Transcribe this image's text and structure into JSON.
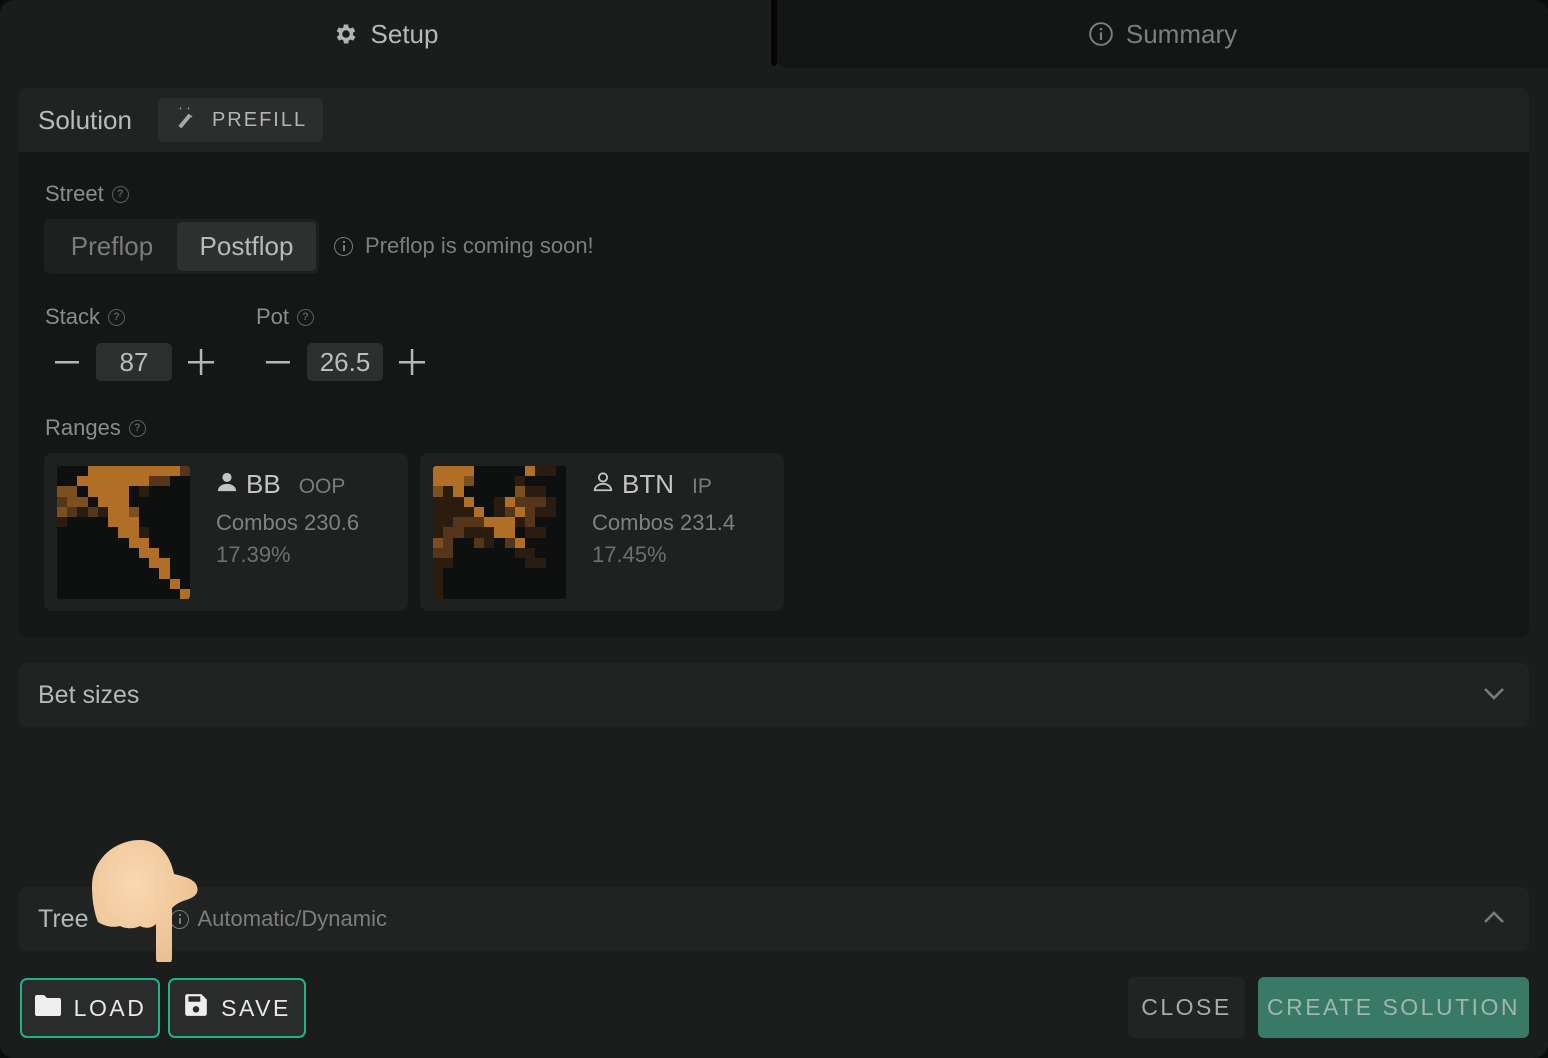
{
  "tabs": [
    {
      "label": "Setup",
      "icon": "gear-icon",
      "active": true
    },
    {
      "label": "Summary",
      "icon": "info-icon",
      "active": false
    }
  ],
  "solution": {
    "title": "Solution",
    "prefill_label": "PREFILL",
    "street": {
      "label": "Street",
      "options": [
        "Preflop",
        "Postflop"
      ],
      "selected": "Postflop",
      "note": "Preflop is coming soon!"
    },
    "stack": {
      "label": "Stack",
      "value": "87"
    },
    "pot": {
      "label": "Pot",
      "value": "26.5"
    },
    "ranges": {
      "label": "Ranges",
      "players": [
        {
          "name": "BB",
          "position": "OOP",
          "combos": "Combos 230.6",
          "percent": "17.39%",
          "icon": "user-filled-icon",
          "grid": [
            [
              0,
              0,
              0,
              4,
              4,
              4,
              4,
              4,
              4,
              4,
              4,
              4,
              2
            ],
            [
              0,
              0,
              4,
              4,
              4,
              4,
              4,
              4,
              4,
              2,
              2,
              0,
              0
            ],
            [
              3,
              3,
              0,
              4,
              4,
              4,
              4,
              0,
              1,
              0,
              0,
              0,
              0
            ],
            [
              2,
              3,
              3,
              0,
              4,
              4,
              4,
              0,
              0,
              0,
              0,
              0,
              0
            ],
            [
              3,
              2,
              1,
              2,
              1,
              4,
              4,
              3,
              0,
              0,
              0,
              0,
              0
            ],
            [
              1,
              0,
              0,
              0,
              0,
              4,
              4,
              4,
              0,
              0,
              0,
              0,
              0
            ],
            [
              0,
              0,
              0,
              0,
              0,
              0,
              4,
              4,
              1,
              0,
              0,
              0,
              0
            ],
            [
              0,
              0,
              0,
              0,
              0,
              0,
              0,
              4,
              4,
              0,
              0,
              0,
              0
            ],
            [
              0,
              0,
              0,
              0,
              0,
              0,
              0,
              0,
              4,
              4,
              0,
              0,
              0
            ],
            [
              0,
              0,
              0,
              0,
              0,
              0,
              0,
              0,
              0,
              4,
              4,
              0,
              0
            ],
            [
              0,
              0,
              0,
              0,
              0,
              0,
              0,
              0,
              0,
              0,
              4,
              0,
              0
            ],
            [
              0,
              0,
              0,
              0,
              0,
              0,
              0,
              0,
              0,
              0,
              0,
              4,
              0
            ],
            [
              0,
              0,
              0,
              0,
              0,
              0,
              0,
              0,
              0,
              0,
              0,
              0,
              4
            ]
          ]
        },
        {
          "name": "BTN",
          "position": "IP",
          "combos": "Combos 231.4",
          "percent": "17.45%",
          "icon": "user-outline-icon",
          "grid": [
            [
              4,
              4,
              4,
              4,
              0,
              0,
              0,
              0,
              0,
              4,
              1,
              1,
              0
            ],
            [
              4,
              4,
              4,
              3,
              0,
              0,
              0,
              0,
              1,
              0,
              0,
              0,
              0
            ],
            [
              3,
              1,
              4,
              0,
              0,
              0,
              0,
              0,
              3,
              1,
              1,
              0,
              0
            ],
            [
              1,
              1,
              1,
              4,
              0,
              0,
              1,
              4,
              2,
              2,
              2,
              1,
              0
            ],
            [
              1,
              1,
              1,
              1,
              4,
              0,
              1,
              2,
              4,
              2,
              1,
              1,
              0
            ],
            [
              1,
              1,
              2,
              2,
              2,
              4,
              4,
              4,
              1,
              2,
              0,
              0,
              0
            ],
            [
              1,
              2,
              2,
              1,
              1,
              1,
              4,
              4,
              0,
              1,
              1,
              0,
              0
            ],
            [
              3,
              2,
              0,
              0,
              2,
              1,
              0,
              2,
              4,
              0,
              0,
              0,
              0
            ],
            [
              2,
              2,
              0,
              0,
              0,
              0,
              0,
              0,
              1,
              1,
              0,
              0,
              0
            ],
            [
              1,
              1,
              0,
              0,
              0,
              0,
              0,
              0,
              0,
              1,
              1,
              0,
              0
            ],
            [
              1,
              0,
              0,
              0,
              0,
              0,
              0,
              0,
              0,
              0,
              0,
              0,
              0
            ],
            [
              1,
              0,
              0,
              0,
              0,
              0,
              0,
              0,
              0,
              0,
              0,
              0,
              0
            ],
            [
              1,
              0,
              0,
              0,
              0,
              0,
              0,
              0,
              0,
              0,
              0,
              0,
              0
            ]
          ]
        }
      ]
    }
  },
  "bet_sizes": {
    "title": "Bet sizes",
    "expanded": false
  },
  "tree": {
    "title": "Tree",
    "subtitle": "Automatic/Dynamic",
    "expanded": true
  },
  "footer": {
    "load_label": "LOAD",
    "save_label": "SAVE",
    "close_label": "CLOSE",
    "create_label": "CREATE SOLUTION"
  },
  "colors": {
    "accent_green": "#1fb38c",
    "create_button": "#387a66",
    "range_levels": [
      "#0e0f0f",
      "#2a1d10",
      "#55361a",
      "#7c4f20",
      "#b06e27"
    ]
  }
}
